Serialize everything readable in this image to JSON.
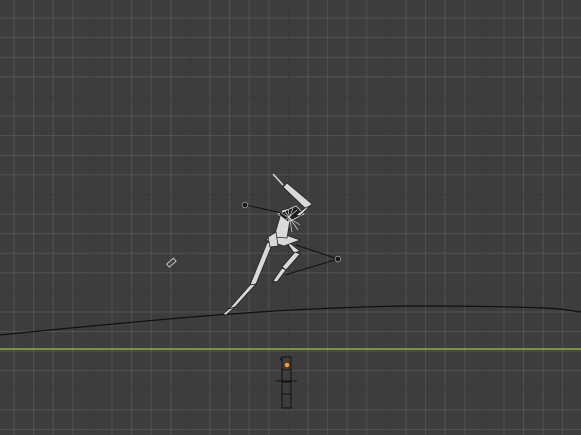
{
  "viewport": {
    "view": "3D Viewport",
    "grid": true,
    "colors": {
      "background": "#3d3d3d",
      "horizon_axis": "#8fb33a",
      "armature": "#e6e6e6",
      "object_origin": "#ff9a1f"
    }
  },
  "scene": {
    "objects": [
      {
        "name": "armature",
        "kind": "skeleton-rig",
        "pose": "running"
      },
      {
        "name": "motion-path-curve",
        "kind": "curve"
      },
      {
        "name": "camera",
        "kind": "camera"
      },
      {
        "name": "empty",
        "kind": "empty"
      }
    ]
  }
}
